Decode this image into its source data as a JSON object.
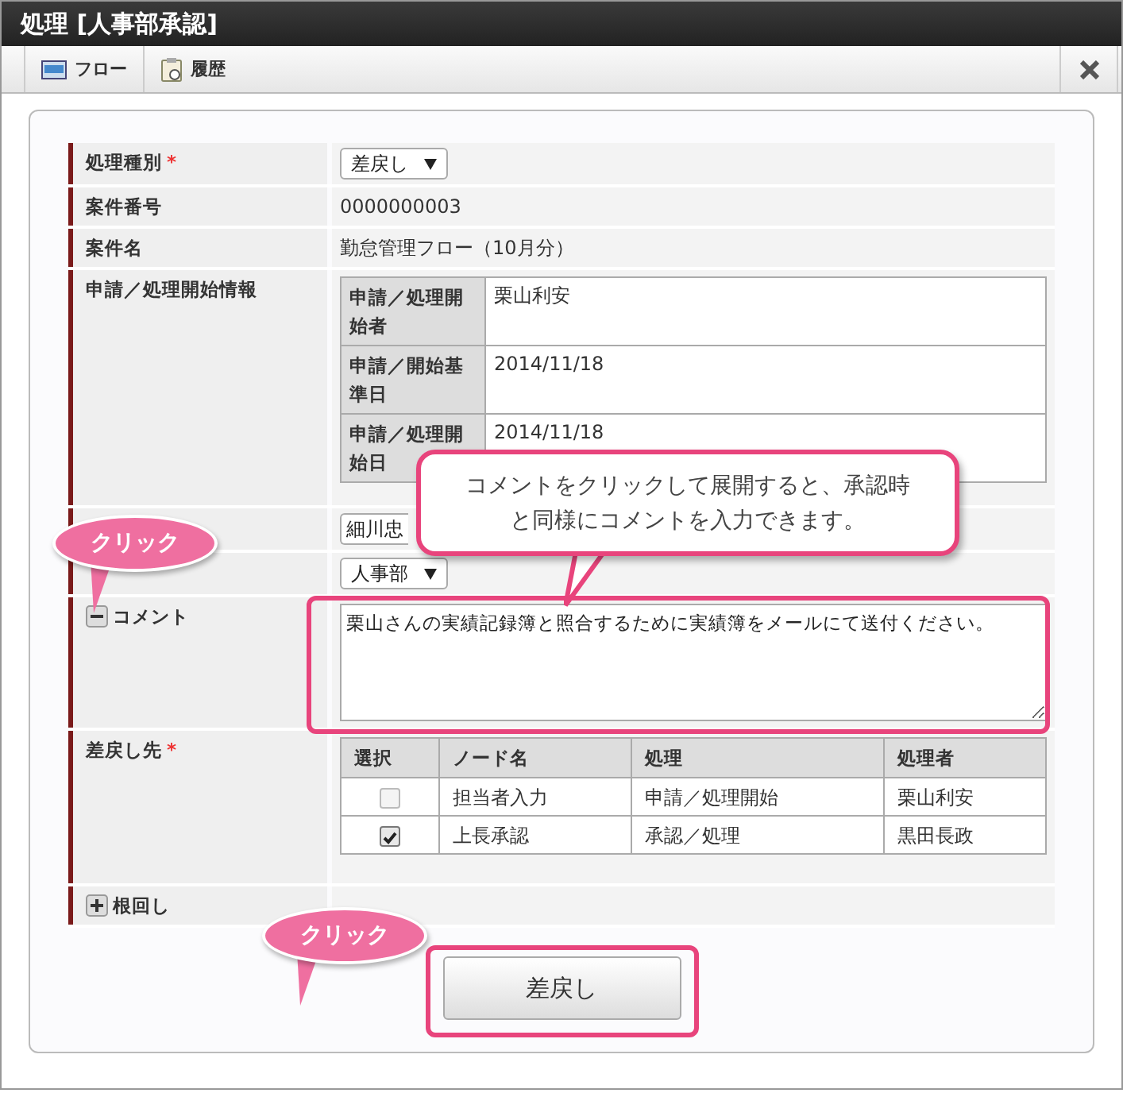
{
  "window": {
    "title": "処理 [人事部承認]"
  },
  "toolbar": [
    {
      "kind": "flow",
      "label": "フロー"
    },
    {
      "kind": "history",
      "label": "履歴"
    }
  ],
  "fields": [
    {
      "kind": "select",
      "label": "処理種別",
      "required": true,
      "required_mark": "*",
      "value": "差戻し"
    },
    {
      "kind": "text",
      "label": "案件番号",
      "value": "0000000003"
    },
    {
      "kind": "text",
      "label": "案件名",
      "value": "勤怠管理フロー（10月分）"
    },
    {
      "kind": "info",
      "label": "申請／処理開始情報",
      "rows": [
        {
          "label": "申請／処理開始者",
          "value": "栗山利安"
        },
        {
          "label": "申請／開始基準日",
          "value": "2014/11/18"
        },
        {
          "label": "申請／処理開始日",
          "value": "2014/11/18"
        }
      ]
    },
    {
      "kind": "select",
      "value": "細川忠"
    },
    {
      "kind": "select",
      "value": "人事部"
    },
    {
      "kind": "comment",
      "label": "コメント",
      "expanded": true,
      "value": "栗山さんの実績記録簿と照合するために実績簿をメールにて送付ください。"
    },
    {
      "kind": "table",
      "label": "差戻し先",
      "required": true,
      "required_mark": "*",
      "columns": [
        "選択",
        "ノード名",
        "処理",
        "処理者"
      ],
      "rows": [
        {
          "selected": false,
          "node": "担当者入力",
          "process": "申請／処理開始",
          "handler": "栗山利安"
        },
        {
          "selected": true,
          "node": "上長承認",
          "process": "承認／処理",
          "handler": "黒田長政"
        }
      ]
    },
    {
      "kind": "toggle",
      "label": "根回し",
      "expanded": false
    }
  ],
  "submit_button": "差戻し",
  "annotations": {
    "note": "コメントをクリックして展開すると、承認時と同様にコメントを入力できます。",
    "clicks": [
      "クリック",
      "クリック"
    ]
  }
}
